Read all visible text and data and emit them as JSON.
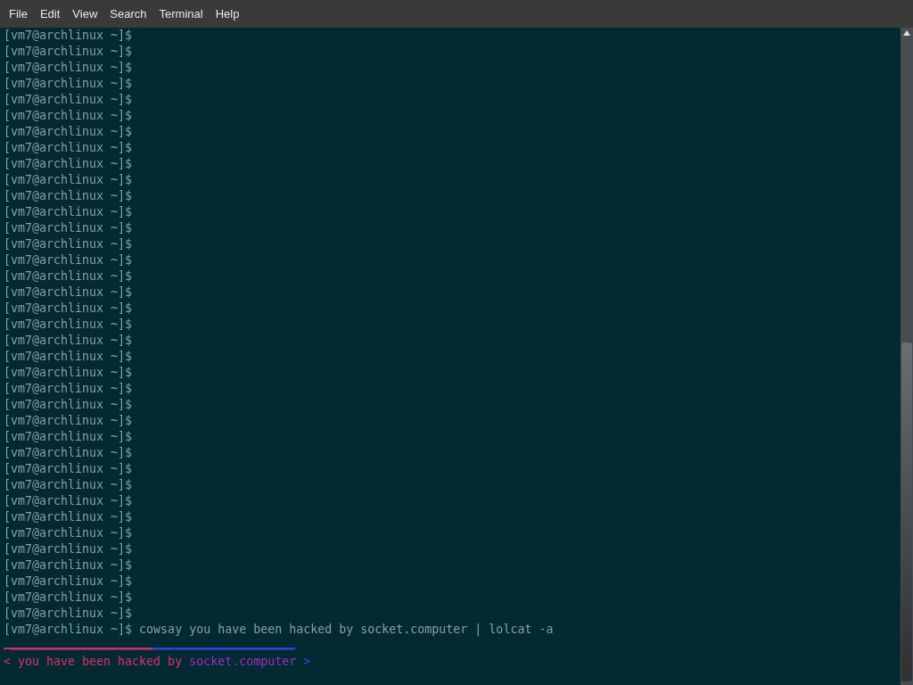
{
  "menu": [
    "File",
    "Edit",
    "View",
    "Search",
    "Terminal",
    "Help"
  ],
  "terminal": {
    "prompt_lines": [
      "[vm7@archlinux ~]$",
      "[vm7@archlinux ~]$",
      "[vm7@archlinux ~]$",
      "[vm7@archlinux ~]$",
      "[vm7@archlinux ~]$",
      "[vm7@archlinux ~]$",
      "[vm7@archlinux ~]$",
      "[vm7@archlinux ~]$",
      "[vm7@archlinux ~]$",
      "[vm7@archlinux ~]$",
      "[vm7@archlinux ~]$",
      "[vm7@archlinux ~]$",
      "[vm7@archlinux ~]$",
      "[vm7@archlinux ~]$",
      "[vm7@archlinux ~]$",
      "[vm7@archlinux ~]$",
      "[vm7@archlinux ~]$",
      "[vm7@archlinux ~]$",
      "[vm7@archlinux ~]$",
      "[vm7@archlinux ~]$",
      "[vm7@archlinux ~]$",
      "[vm7@archlinux ~]$",
      "[vm7@archlinux ~]$",
      "[vm7@archlinux ~]$",
      "[vm7@archlinux ~]$",
      "[vm7@archlinux ~]$",
      "[vm7@archlinux ~]$",
      "[vm7@archlinux ~]$",
      "[vm7@archlinux ~]$",
      "[vm7@archlinux ~]$",
      "[vm7@archlinux ~]$",
      "[vm7@archlinux ~]$",
      "[vm7@archlinux ~]$",
      "[vm7@archlinux ~]$",
      "[vm7@archlinux ~]$",
      "[vm7@archlinux ~]$",
      "[vm7@archlinux ~]$"
    ],
    "command": {
      "prompt": "[vm7@archlinux ~]$",
      "text": "cowsay you have been hacked by socket.computer | lolcat -a"
    },
    "output_lines": [
      [
        {
          "text": " ____________________",
          "color": "#c8306e"
        },
        {
          "text": "____________________",
          "color": "#3a3ed8"
        }
      ],
      [
        {
          "text": "< you have been hacked by ",
          "color": "#e0306a"
        },
        {
          "text": "socket.computer",
          "color": "#9a2fc0"
        },
        {
          "text": " >",
          "color": "#4a4ae0"
        }
      ]
    ]
  }
}
